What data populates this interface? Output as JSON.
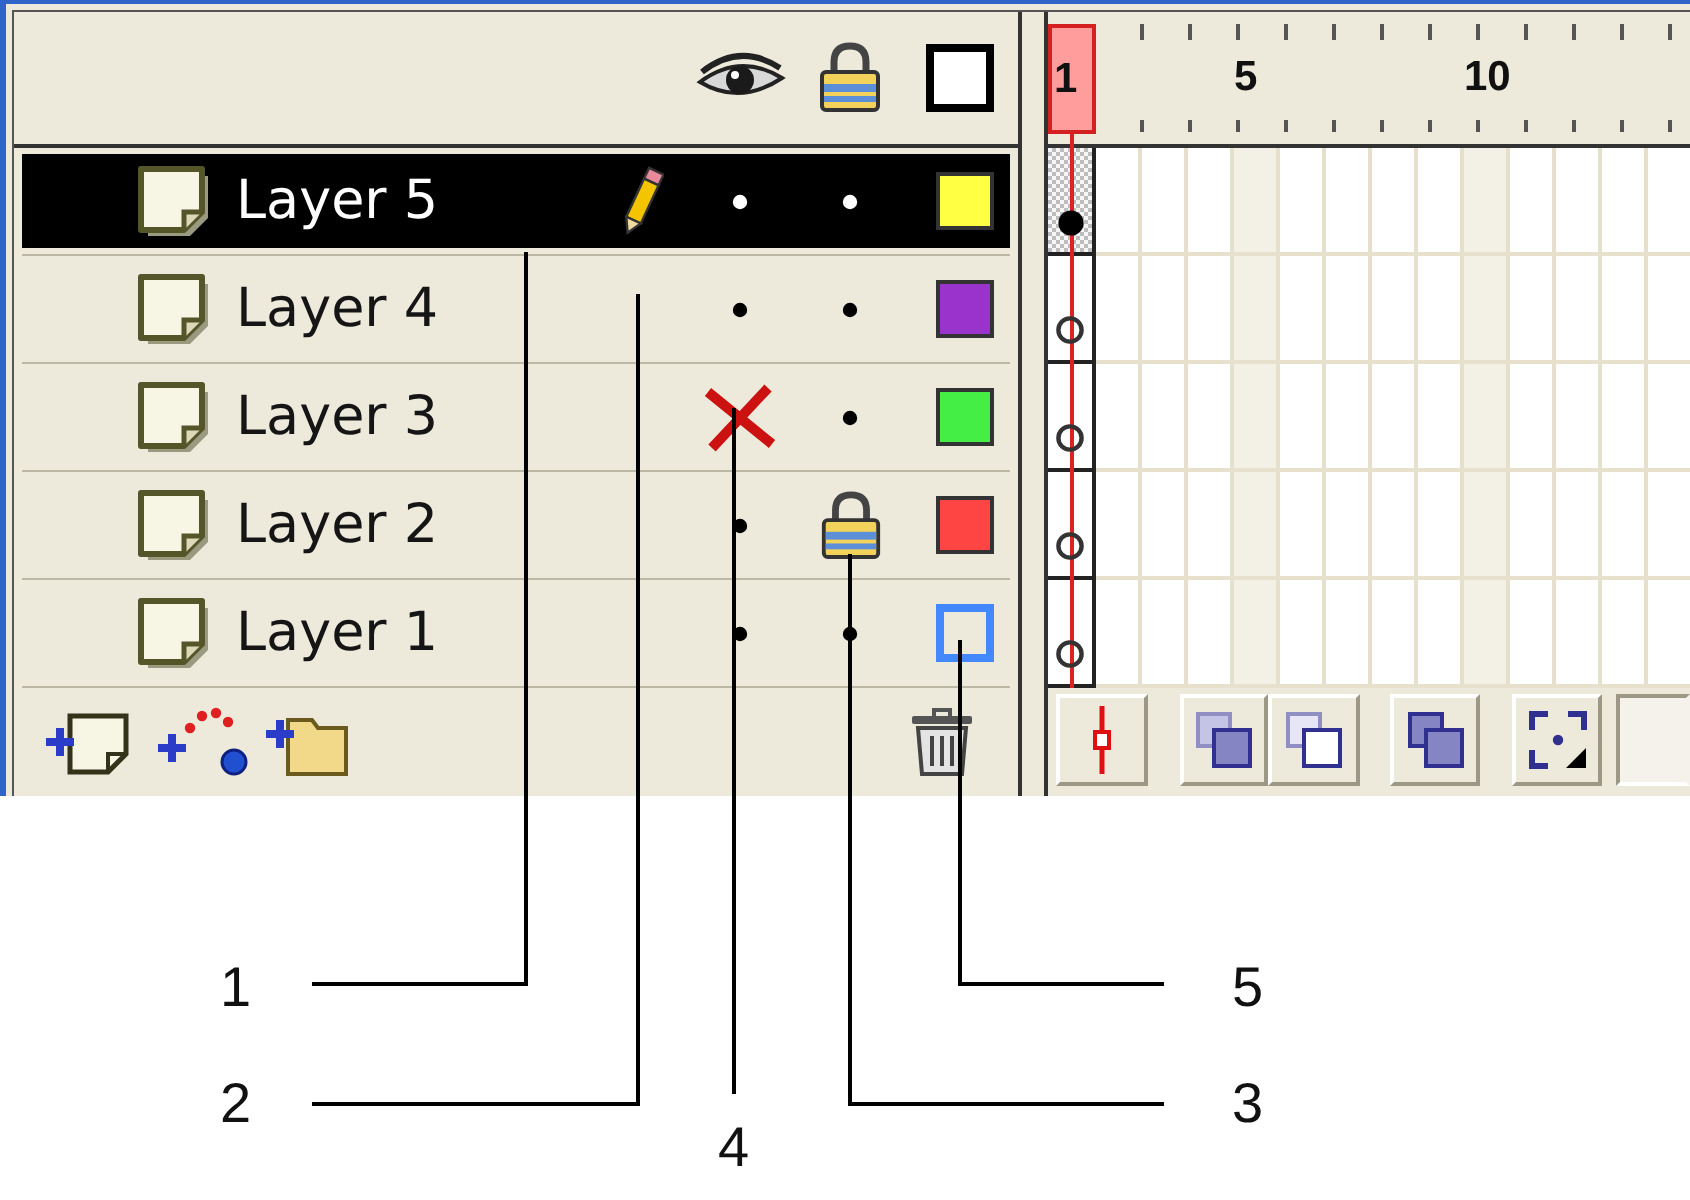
{
  "layers_panel": {
    "layers": [
      {
        "name": "Layer 5",
        "selected": true,
        "editing": true,
        "visible": true,
        "locked": false,
        "outline": false,
        "color": "#ffff44",
        "keyframe_filled": true
      },
      {
        "name": "Layer 4",
        "selected": false,
        "editing": false,
        "visible": true,
        "locked": false,
        "outline": false,
        "color": "#9933cc",
        "keyframe_filled": false
      },
      {
        "name": "Layer 3",
        "selected": false,
        "editing": false,
        "visible": false,
        "locked": false,
        "outline": false,
        "color": "#44ee44",
        "keyframe_filled": false
      },
      {
        "name": "Layer 2",
        "selected": false,
        "editing": false,
        "visible": true,
        "locked": true,
        "outline": false,
        "color": "#ff4444",
        "keyframe_filled": false
      },
      {
        "name": "Layer 1",
        "selected": false,
        "editing": false,
        "visible": true,
        "locked": false,
        "outline": true,
        "color": "#4488ff",
        "keyframe_filled": false
      }
    ]
  },
  "timeline": {
    "playhead": {
      "label": "1"
    },
    "frame_numbers": [
      "5",
      "10"
    ]
  },
  "callouts": [
    {
      "label": "1"
    },
    {
      "label": "5"
    },
    {
      "label": "2"
    },
    {
      "label": "3"
    },
    {
      "label": "4"
    }
  ]
}
